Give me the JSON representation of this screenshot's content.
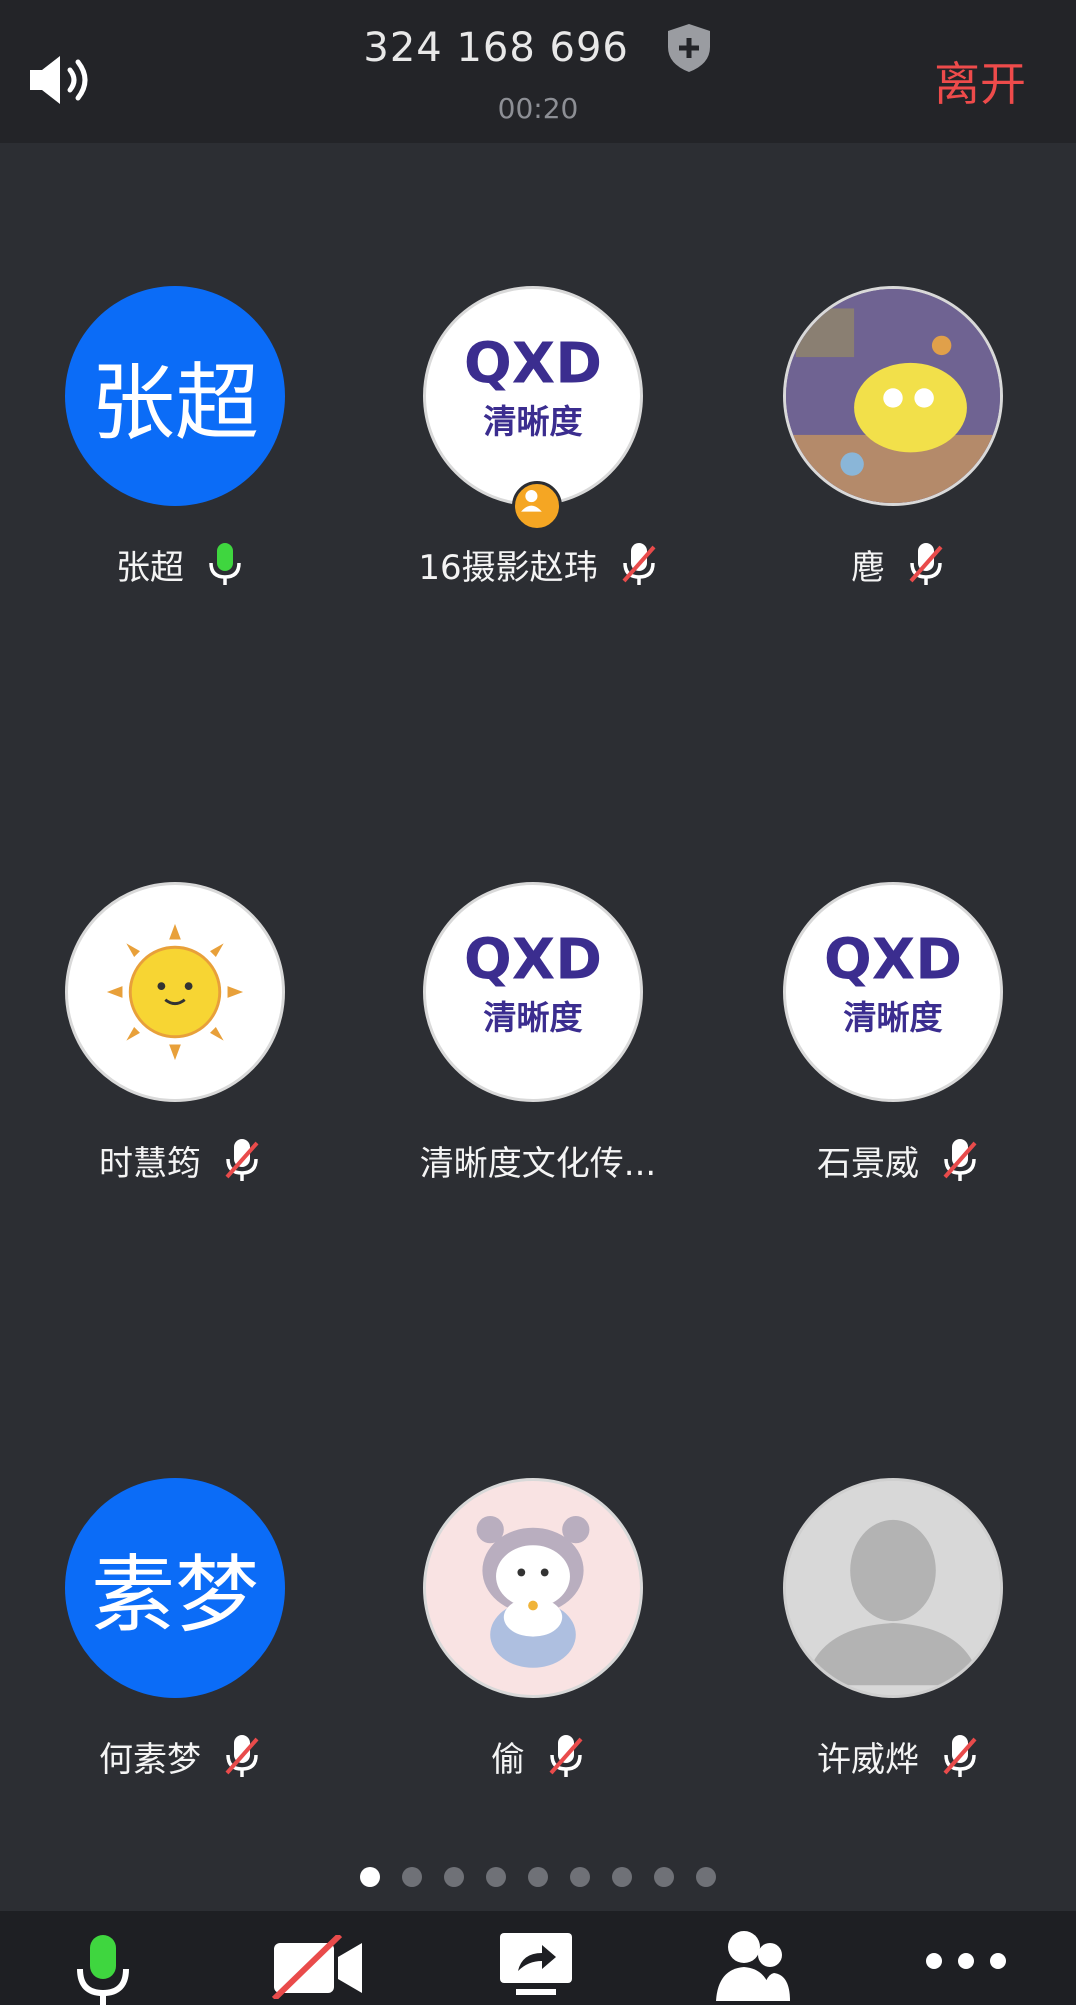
{
  "header": {
    "meeting_id": "324 168 696",
    "timer": "00:20",
    "leave_label": "离开",
    "accent_leave": "#ee4b4b"
  },
  "participants": [
    {
      "name": "张超",
      "avatar_type": "initials",
      "initials": "张超",
      "mic": "on"
    },
    {
      "name": "16摄影赵玮",
      "avatar_type": "qxd-logo",
      "host": true,
      "mic": "muted"
    },
    {
      "name": "麀",
      "avatar_type": "photo-cartoon-spongebob",
      "mic": "muted"
    },
    {
      "name": "时慧筠",
      "avatar_type": "sun-emoji",
      "mic": "muted"
    },
    {
      "name": "清晰度文化传...",
      "avatar_type": "qxd-logo",
      "mic": "none"
    },
    {
      "name": "石景威",
      "avatar_type": "qxd-logo",
      "mic": "muted"
    },
    {
      "name": "何素梦",
      "avatar_type": "initials",
      "initials": "素梦",
      "mic": "muted"
    },
    {
      "name": "偷",
      "avatar_type": "cartoon-cat",
      "mic": "muted"
    },
    {
      "name": "许威烨",
      "avatar_type": "default-silhouette",
      "mic": "muted"
    }
  ],
  "logo": {
    "top": "QXD",
    "bottom": "清晰度",
    "color": "#3b2d8f"
  },
  "pagination": {
    "total": 9,
    "current": 1
  },
  "toolbar": {
    "items": [
      "mic-icon",
      "video-off-icon",
      "share-icon",
      "participants-icon",
      "more-icon"
    ]
  },
  "colors": {
    "avatar_blue": "#0b6cf7",
    "mic_on_green": "#3fd63f",
    "mute_red": "#e94b4b"
  }
}
